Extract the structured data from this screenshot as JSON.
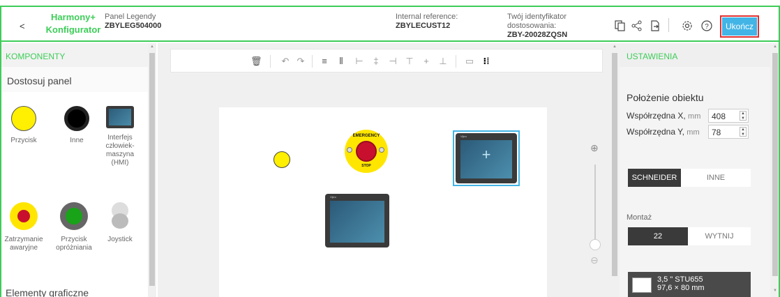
{
  "header": {
    "back_label": "<",
    "app_name_line1": "Harmony+",
    "app_name_line2": "Konfigurator",
    "legend_label": "Panel Legendy",
    "legend_value": "ZBYLEG504000",
    "internal_ref_label": "Internal reference:",
    "internal_ref_value": "ZBYLECUST12",
    "identifier_label_1": "Twój identyfikator",
    "identifier_label_2": "dostosowania:",
    "identifier_value": "ZBY-20028ZQSN",
    "finish_label": "Ukończ"
  },
  "left_panel": {
    "title": "KOMPONENTY",
    "section": "Dostosuj panel",
    "components": [
      {
        "label": "Przycisk",
        "icon": "yellow-button-icon"
      },
      {
        "label": "Inne",
        "icon": "black-button-icon"
      },
      {
        "label": "Interfejs człowiek-maszyna (HMI)",
        "icon": "hmi-icon"
      },
      {
        "label": "Zatrzymanie awaryjne",
        "icon": "emergency-stop-icon"
      },
      {
        "label": "Przycisk opróżniania",
        "icon": "green-button-icon"
      },
      {
        "label": "Joystick",
        "icon": "joystick-icon"
      }
    ],
    "graphic_elements": "Elementy graficzne"
  },
  "canvas": {
    "estop_top_text": "EMERGENCY",
    "estop_bottom_text": "STOP",
    "hmi_brand": "Vijeo",
    "plus_symbol": "+"
  },
  "right_panel": {
    "title": "USTAWIENIA",
    "position_title": "Położenie obiektu",
    "x_label": "Współrzędna X,",
    "y_label": "Współrzędna Y,",
    "unit": "mm",
    "x_value": "408",
    "y_value": "78",
    "brand_tabs": [
      "SCHNEIDER",
      "INNE"
    ],
    "mount_label": "Montaż",
    "mount_tabs": [
      "22",
      "WYTNIJ"
    ],
    "product_size": "3,5 \" STU655",
    "product_dims": "97,6 × 80 mm"
  },
  "colors": {
    "accent_green": "#3dcd58",
    "finish_blue": "#42b4e6",
    "highlight_red": "#e03030"
  }
}
